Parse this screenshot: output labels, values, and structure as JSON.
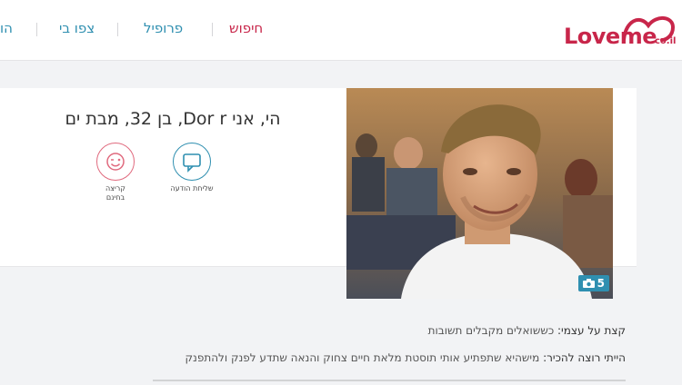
{
  "header": {
    "logo_text": "Loveme",
    "logo_tld": "co.il",
    "nav": [
      {
        "label": "חיפוש",
        "active": true
      },
      {
        "label": "פרופיל",
        "active": false
      },
      {
        "label": "צפו בי",
        "active": false
      },
      {
        "label": "הו",
        "active": false
      }
    ]
  },
  "profile": {
    "headline": "הי, אני Dor r, בן 32, מבת ים",
    "photo_count": "5",
    "actions": {
      "message_label": "שליחת הודעה",
      "wink_label_line1": "קריצה",
      "wink_label_line2": "בחינם"
    }
  },
  "about": {
    "line1_title": "קצת על עצמי:",
    "line1_text": "כששואלים מקבלים תשובות",
    "line2_title": "הייתי רוצה להכיר:",
    "line2_text": "מישהיא שתפתיע אותי תוסטת מלאת חיים צחוק והנאה שתדע לפנק ולהתפנק"
  },
  "colors": {
    "brand": "#c8264a",
    "message_icon": "#2f8fb0",
    "wink_icon": "#e06a7e",
    "photo_badge": "#2f8fb0"
  }
}
